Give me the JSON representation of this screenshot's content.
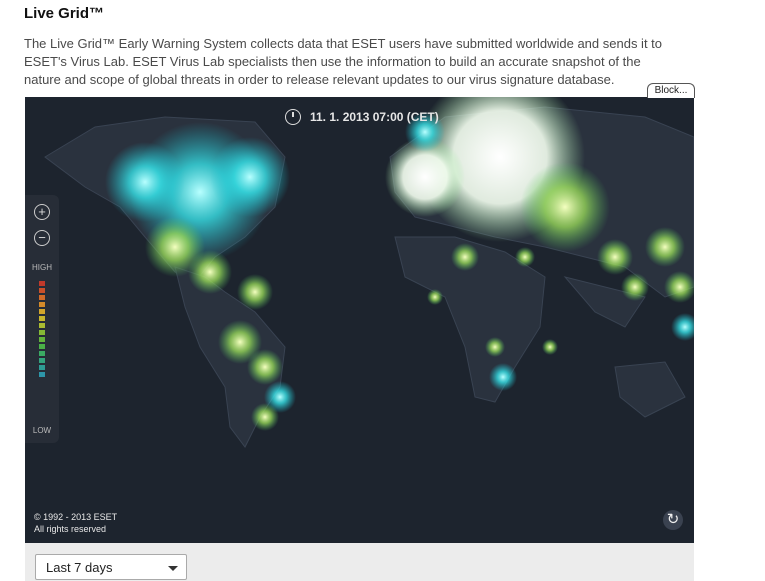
{
  "header": {
    "title": "Live Grid™",
    "description": "The Live Grid™ Early Warning System collects data that ESET users have submitted worldwide and sends it to ESET's Virus Lab. ESET Virus Lab specialists then use the information to build an accurate snapshot of the nature and scope of global threats in order to release relevant updates to our virus signature database."
  },
  "block_button": "Block...",
  "map": {
    "timestamp": "11. 1. 2013 07:00 (CET)",
    "zoom_in": "+",
    "zoom_out": "−",
    "scale_high": "HIGH",
    "scale_low": "LOW",
    "copyright": "© 1992 - 2013 ESET",
    "rights": "All rights reserved",
    "refresh_icon": "↻",
    "scale_colors": [
      "#c0392b",
      "#c9502a",
      "#d06a29",
      "#d38a2a",
      "#d2a52b",
      "#c7b52d",
      "#a9bb31",
      "#86b935",
      "#63b43a",
      "#4ab047",
      "#3aaa63",
      "#33a37d",
      "#2e9c94",
      "#2d95a8"
    ]
  },
  "filter": {
    "selected": "Last 7 days"
  }
}
